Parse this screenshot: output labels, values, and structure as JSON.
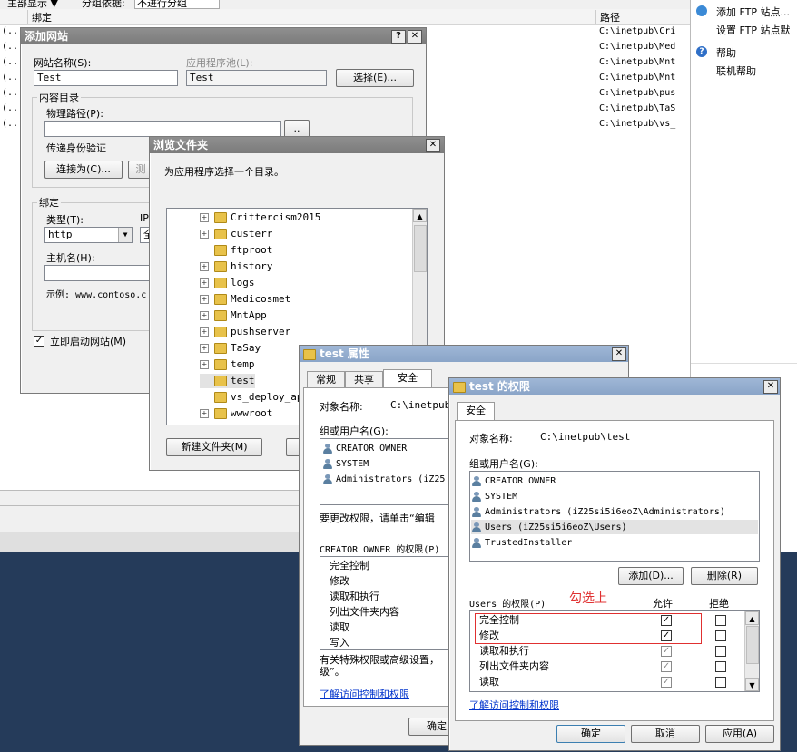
{
  "background": {
    "top_left_fragment": "主部显示 ▼",
    "group_by_label": "分组依据:",
    "group_by_value": "不进行分组",
    "columns": {
      "binding": "绑定",
      "path": "路径"
    },
    "site_rows_prefix": "(...",
    "site_paths": [
      "C:\\inetpub\\Cri",
      "C:\\inetpub\\Med",
      "C:\\inetpub\\Mnt",
      "C:\\inetpub\\Mnt",
      "C:\\inetpub\\pus",
      "C:\\inetpub\\TaS",
      "C:\\inetpub\\vs_"
    ],
    "actions": {
      "add_ftp": "添加 FTP 站点...",
      "ftp_defaults": "设置 FTP 站点默",
      "help": "帮助",
      "online_help": "联机帮助"
    }
  },
  "add_site": {
    "title": "添加网站",
    "site_name_label": "网站名称(S):",
    "site_name_value": "Test",
    "app_pool_label": "应用程序池(L):",
    "app_pool_value": "Test",
    "select_button": "选择(E)...",
    "content_dir_label": "内容目录",
    "physical_path_label": "物理路径(P):",
    "browse_button": "..",
    "passthrough_label": "传递身份验证",
    "connect_as_button": "连接为(C)...",
    "test_button_fragment": "测",
    "binding_label": "绑定",
    "type_label": "类型(T):",
    "type_value": "http",
    "ip_fragment": "IP",
    "ip_value_fragment": "全",
    "host_label": "主机名(H):",
    "example_label": "示例: www.contoso.c",
    "start_site_label": "立即启动网站(M)",
    "start_site_checked": true
  },
  "browse": {
    "title": "浏览文件夹",
    "prompt": "为应用程序选择一个目录。",
    "items": [
      {
        "name": "Crittercism2015",
        "expandable": true
      },
      {
        "name": "custerr",
        "expandable": true
      },
      {
        "name": "ftproot",
        "expandable": false
      },
      {
        "name": "history",
        "expandable": true
      },
      {
        "name": "logs",
        "expandable": true
      },
      {
        "name": "Medicosmet",
        "expandable": true
      },
      {
        "name": "MntApp",
        "expandable": true
      },
      {
        "name": "pushserver",
        "expandable": true
      },
      {
        "name": "TaSay",
        "expandable": true
      },
      {
        "name": "temp",
        "expandable": true
      },
      {
        "name": "test",
        "expandable": false,
        "selected": true
      },
      {
        "name": "vs_deploy_app",
        "expandable": false
      },
      {
        "name": "wwwroot",
        "expandable": true
      }
    ],
    "new_folder_button": "新建文件夹(M)"
  },
  "props": {
    "title": "test 属性",
    "tabs": [
      "常规",
      "共享",
      "安全"
    ],
    "object_label": "对象名称:",
    "object_value": "C:\\inetpub\\",
    "group_label": "组或用户名(G):",
    "users": [
      "CREATOR OWNER",
      "SYSTEM",
      "Administrators (iZ25"
    ],
    "change_hint": "要更改权限，请单击“编辑",
    "perm_label": "CREATOR OWNER 的权限(P)",
    "perms": [
      "完全控制",
      "修改",
      "读取和执行",
      "列出文件夹内容",
      "读取",
      "写入"
    ],
    "special_hint_1": "有关特殊权限或高级设置，",
    "special_hint_2": "级”。",
    "learn_link": "了解访问控制和权限",
    "ok_fragment": "确定"
  },
  "perm": {
    "title": "test 的权限",
    "tab": "安全",
    "object_label": "对象名称:",
    "object_value": "C:\\inetpub\\test",
    "group_label": "组或用户名(G):",
    "users": [
      {
        "name": "CREATOR OWNER",
        "selected": false
      },
      {
        "name": "SYSTEM",
        "selected": false
      },
      {
        "name": "Administrators (iZ25si5i6eoZ\\Administrators)",
        "selected": false
      },
      {
        "name": "Users (iZ25si5i6eoZ\\Users)",
        "selected": true
      },
      {
        "name": "TrustedInstaller",
        "selected": false
      }
    ],
    "add_button": "添加(D)...",
    "remove_button": "删除(R)",
    "perm_label": "Users 的权限(P)",
    "annotation": "勾选上",
    "allow_label": "允许",
    "deny_label": "拒绝",
    "perms": [
      {
        "name": "完全控制",
        "allow": "checked",
        "deny": "unchecked"
      },
      {
        "name": "修改",
        "allow": "checked",
        "deny": "unchecked"
      },
      {
        "name": "读取和执行",
        "allow": "inherited",
        "deny": "unchecked"
      },
      {
        "name": "列出文件夹内容",
        "allow": "inherited",
        "deny": "unchecked"
      },
      {
        "name": "读取",
        "allow": "inherited",
        "deny": "unchecked"
      }
    ],
    "learn_link": "了解访问控制和权限",
    "ok_button": "确定",
    "cancel_button": "取消",
    "apply_button": "应用(A)"
  },
  "colors": {
    "annotation_red": "#e03030",
    "desktop_blue": "#253b5a",
    "link_blue": "#0033cc"
  }
}
